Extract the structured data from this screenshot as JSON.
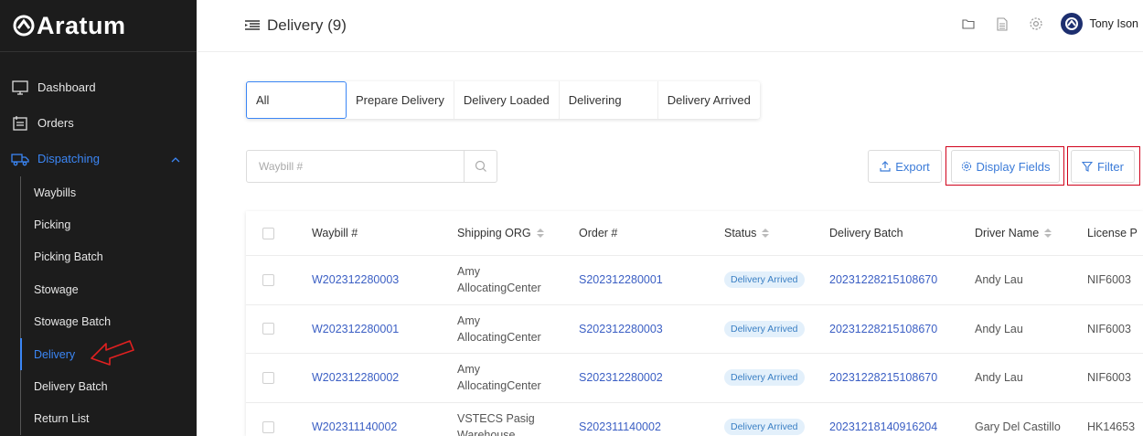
{
  "brand": {
    "name": "Aratum"
  },
  "sidebar": {
    "items": [
      {
        "label": "Dashboard",
        "icon": "monitor-icon"
      },
      {
        "label": "Orders",
        "icon": "orders-icon"
      },
      {
        "label": "Dispatching",
        "icon": "truck-icon"
      }
    ],
    "dispatching_children": [
      {
        "label": "Waybills"
      },
      {
        "label": "Picking"
      },
      {
        "label": "Picking Batch"
      },
      {
        "label": "Stowage"
      },
      {
        "label": "Stowage Batch"
      },
      {
        "label": "Delivery"
      },
      {
        "label": "Delivery Batch"
      },
      {
        "label": "Return List"
      }
    ],
    "selected": "Delivery"
  },
  "header": {
    "title": "Delivery (9)",
    "user_name": "Tony Ison"
  },
  "tabs": [
    {
      "label": "All"
    },
    {
      "label": "Prepare Delivery"
    },
    {
      "label": "Delivery Loaded"
    },
    {
      "label": "Delivering"
    },
    {
      "label": "Delivery Arrived"
    }
  ],
  "search": {
    "placeholder": "Waybill #"
  },
  "actions": {
    "export": "Export",
    "display_fields": "Display Fields",
    "filter": "Filter"
  },
  "table": {
    "columns": {
      "waybill": "Waybill #",
      "shipping_org": "Shipping ORG",
      "order": "Order #",
      "status": "Status",
      "delivery_batch": "Delivery Batch",
      "driver_name": "Driver Name",
      "license": "License P"
    },
    "rows": [
      {
        "waybill": "W202312280003",
        "shipping_org_1": "Amy",
        "shipping_org_2": "AllocatingCenter",
        "order": "S202312280001",
        "status": "Delivery Arrived",
        "delivery_batch": "20231228215108670",
        "driver_name": "Andy Lau",
        "license": "NIF6003"
      },
      {
        "waybill": "W202312280001",
        "shipping_org_1": "Amy",
        "shipping_org_2": "AllocatingCenter",
        "order": "S202312280003",
        "status": "Delivery Arrived",
        "delivery_batch": "20231228215108670",
        "driver_name": "Andy Lau",
        "license": "NIF6003"
      },
      {
        "waybill": "W202312280002",
        "shipping_org_1": "Amy",
        "shipping_org_2": "AllocatingCenter",
        "order": "S202312280002",
        "status": "Delivery Arrived",
        "delivery_batch": "20231228215108670",
        "driver_name": "Andy Lau",
        "license": "NIF6003"
      },
      {
        "waybill": "W202311140002",
        "shipping_org_1": "VSTECS Pasig",
        "shipping_org_2": "Warehouse",
        "order": "S202311140002",
        "status": "Delivery Arrived",
        "delivery_batch": "20231218140916204",
        "driver_name": "Gary Del Castillo",
        "license": "HK14653"
      }
    ]
  },
  "colors": {
    "accent": "#3b86f5",
    "link": "#3b5fc4",
    "highlight": "#d0021b",
    "sidebar_bg": "#1c1c1c"
  }
}
